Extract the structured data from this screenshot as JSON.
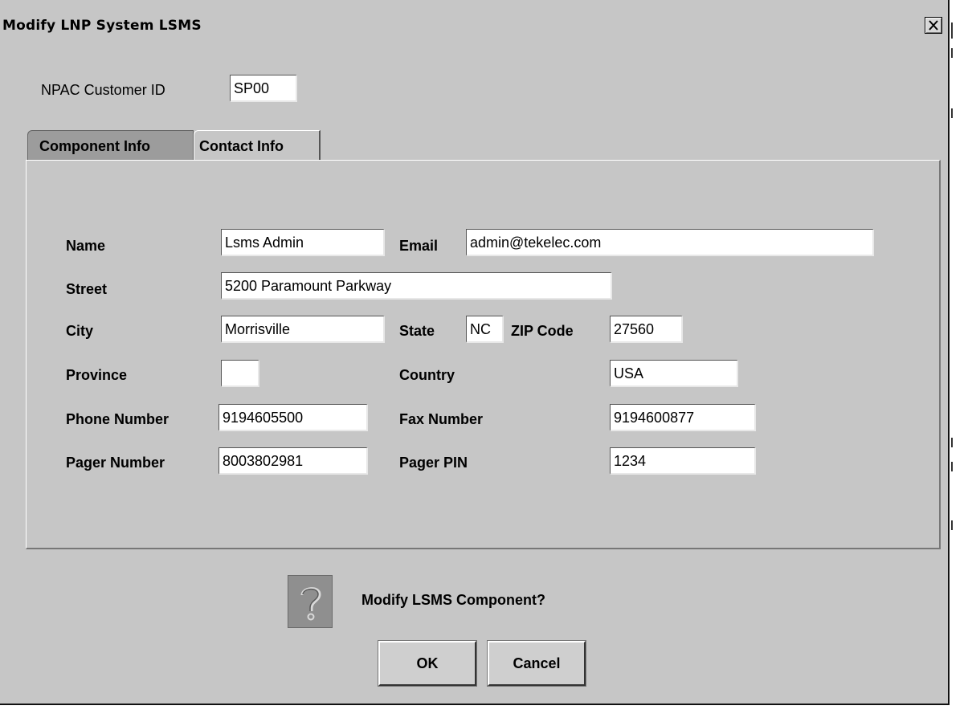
{
  "window": {
    "title": "Modify LNP System LSMS",
    "close_glyph": "×"
  },
  "customer": {
    "label": "NPAC Customer ID",
    "value": "SP00"
  },
  "tabs": [
    {
      "label": "Component Info",
      "selected": true
    },
    {
      "label": "Contact Info",
      "selected": false
    }
  ],
  "form": {
    "name_label": "Name",
    "name_value": "Lsms Admin",
    "email_label": "Email",
    "email_value": "admin@tekelec.com",
    "street_label": "Street",
    "street_value": "5200 Paramount Parkway",
    "city_label": "City",
    "city_value": "Morrisville",
    "state_label": "State",
    "state_value": "NC",
    "zip_label": "ZIP Code",
    "zip_value": "27560",
    "province_label": "Province",
    "province_value": "",
    "country_label": "Country",
    "country_value": "USA",
    "phone_label": "Phone Number",
    "phone_value": "9194605500",
    "fax_label": "Fax Number",
    "fax_value": "9194600877",
    "pager_label": "Pager Number",
    "pager_value": "8003802981",
    "pager_pin_label": "Pager PIN",
    "pager_pin_value": "1234"
  },
  "confirm": {
    "icon": "question-icon",
    "message": "Modify LSMS Component?",
    "ok_label": "OK",
    "cancel_label": "Cancel"
  }
}
